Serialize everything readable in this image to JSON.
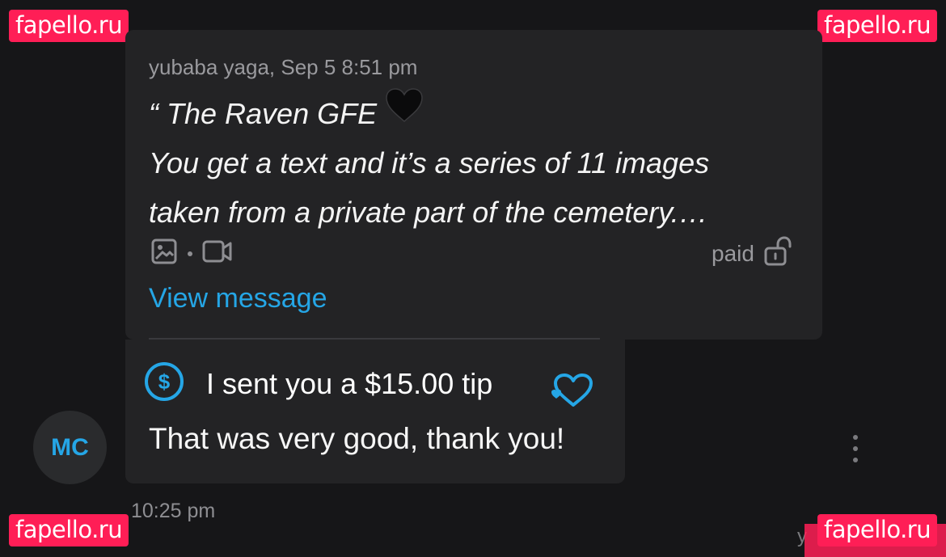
{
  "watermark": {
    "text": "fapello.ru",
    "color": "#ff1e56"
  },
  "quoted_message": {
    "sender_line": "yubaba yaga, Sep 5 8:51 pm",
    "title_line": "“ The Raven GFE",
    "title_emoji": "black-heart-icon",
    "body_line_1": "You get a text and it’s a series of 11 images",
    "body_line_2": "taken from a private part of the cemetery.…",
    "media_icons": [
      "image-icon",
      "video-icon"
    ],
    "paid_label": "paid",
    "lock_icon": "unlocked-padlock-icon",
    "view_link": "View message"
  },
  "message": {
    "tip_icon": "dollar-circle-icon",
    "tip_text": "I sent you a $15.00 tip",
    "tip_heart_icon": "heart-outline-icon",
    "text": "That was very good, thank you!",
    "time": "10:25 pm"
  },
  "sender": {
    "initials": "MC"
  },
  "bottom_partial_text": "y",
  "colors": {
    "background": "#161618",
    "bubble": "#232325",
    "accent": "#25a6e6",
    "muted_text": "#9a9a9e"
  }
}
